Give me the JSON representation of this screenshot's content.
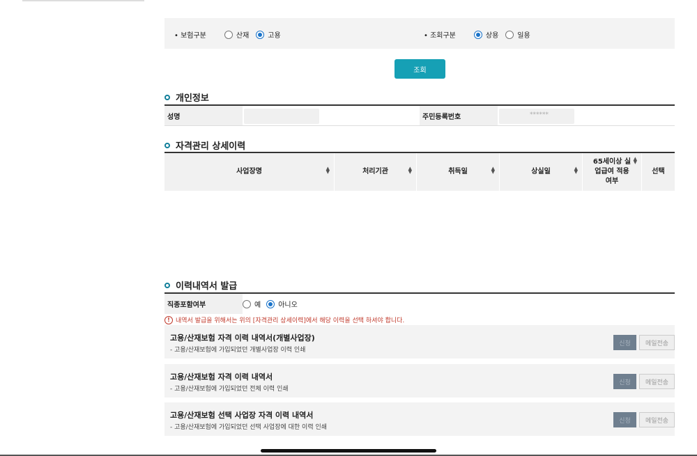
{
  "filter": {
    "insurance_label": "• 보험구분",
    "insurance_options": [
      {
        "label": "산재",
        "checked": false
      },
      {
        "label": "고용",
        "checked": true
      }
    ],
    "inquiry_label": "• 조회구분",
    "inquiry_options": [
      {
        "label": "상용",
        "checked": true
      },
      {
        "label": "일용",
        "checked": false
      }
    ]
  },
  "search_button": "조회",
  "personal": {
    "title": "개인정보",
    "name_label": "성명",
    "name_value": "",
    "rrn_label": "주민등록번호",
    "rrn_value": "******"
  },
  "history": {
    "title": "자격관리 상세이력",
    "columns": [
      "사업장명",
      "처리기관",
      "취득일",
      "상실일",
      "65세이상 실업급여 적용여부",
      "선택"
    ]
  },
  "issuance": {
    "title": "이력내역서 발급",
    "include_label": "직종포함여부",
    "options": [
      {
        "label": "예",
        "checked": false
      },
      {
        "label": "아니오",
        "checked": true
      }
    ],
    "warning": "내역서 발급을 위해서는 위의 [자격관리 상세이력]에서 해당 이력을 선택 하셔야 합니다.",
    "docs": [
      {
        "title": "고용/산재보험 자격 이력 내역서(개별사업장)",
        "desc": "- 고용/산재보험에 가입되었던 개별사업장 이력 인쇄",
        "apply": "신청",
        "mail": "메일전송"
      },
      {
        "title": "고용/산재보험 자격 이력 내역서",
        "desc": "- 고용/산재보험에 가입되었던 전체 이력 인쇄",
        "apply": "신청",
        "mail": "메일전송"
      },
      {
        "title": "고용/산재보험 선택 사업장 자격 이력 내역서",
        "desc": "- 고용/산재보험에 가입되었던 선택 사업장에 대한 이력 인쇄",
        "apply": "신청",
        "mail": "메일전송"
      }
    ]
  },
  "colors": {
    "accent": "#16a0b5",
    "radio": "#1a73c9",
    "warning": "#c0392b"
  }
}
